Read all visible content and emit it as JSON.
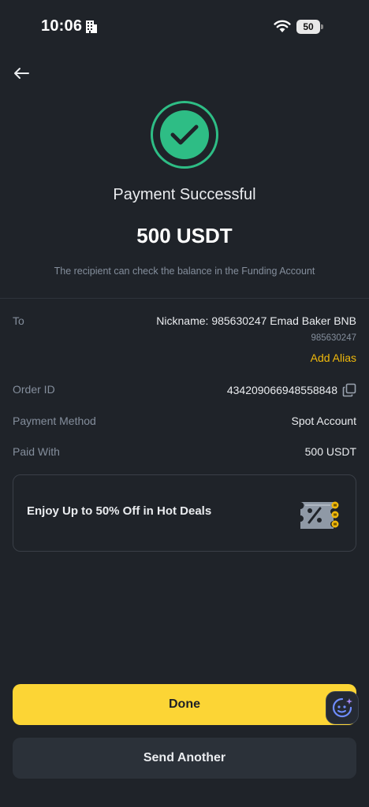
{
  "status_bar": {
    "time": "10:06",
    "battery": "50",
    "icons": [
      "building-icon",
      "wifi-icon",
      "battery-icon"
    ]
  },
  "header": {
    "back_icon": "arrow-left-icon"
  },
  "result": {
    "icon": "check-circle-icon",
    "title": "Payment Successful",
    "amount": "500 USDT",
    "note": "The recipient can check the balance in the Funding Account"
  },
  "details": {
    "to_label": "To",
    "to_nickname": "Nickname: 985630247 Emad Baker BNB",
    "to_uid": "985630247",
    "add_alias": "Add Alias",
    "order_id_label": "Order ID",
    "order_id_value": "434209066948558848",
    "payment_method_label": "Payment Method",
    "payment_method_value": "Spot Account",
    "paid_with_label": "Paid With",
    "paid_with_value": "500 USDT"
  },
  "promo": {
    "text": "Enjoy Up to 50% Off in Hot Deals",
    "icon": "discount-ticket-icon"
  },
  "actions": {
    "done": "Done",
    "send_another": "Send Another",
    "assistant_icon": "ai-assistant-icon"
  },
  "colors": {
    "background": "#1f2329",
    "success": "#2ebd85",
    "accent": "#fcd535",
    "link": "#f0b90b",
    "muted_text": "#848e9c"
  }
}
